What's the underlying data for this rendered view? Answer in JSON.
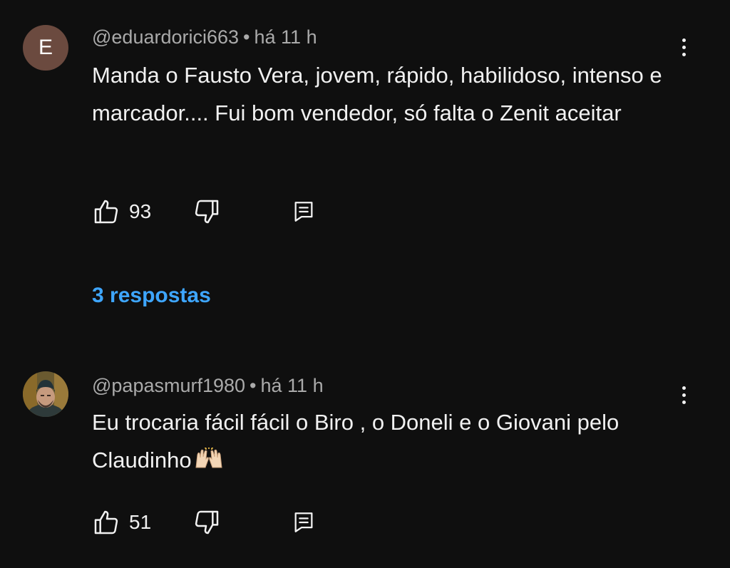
{
  "comments": [
    {
      "avatar_letter": "E",
      "author": "@eduardorici663",
      "separator": "•",
      "time": "há 11 h",
      "text": "Manda o Fausto Vera, jovem, rápido, habilidoso, intenso e marcador.... Fui bom vendedor, só falta o Zenit aceitar",
      "likes": "93",
      "replies_label": "3 respostas"
    },
    {
      "author": "@papasmurf1980",
      "separator": "•",
      "time": "há 11 h",
      "text": "Eu trocaria fácil fácil o Biro , o Doneli e o Giovani pelo Claudinho",
      "emoji": "raising-hands",
      "likes": "51"
    }
  ],
  "icons": {
    "like": "thumb-up-icon",
    "dislike": "thumb-down-icon",
    "reply": "comment-reply-icon",
    "more": "more-vertical-icon"
  },
  "colors": {
    "background": "#0f0f0f",
    "text": "#f1f1f1",
    "meta": "#aaaaaa",
    "link": "#3ea6ff",
    "avatar_bg": "#6b4a3f"
  }
}
